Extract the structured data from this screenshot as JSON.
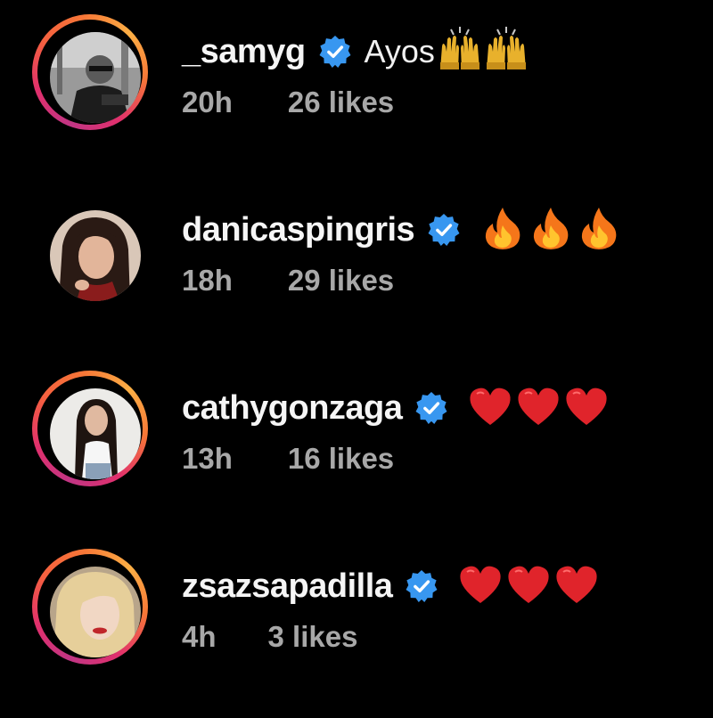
{
  "comments": [
    {
      "username": "_samyg",
      "verified": true,
      "text": "Ayos",
      "emoji": [
        "raising-hands",
        "raising-hands"
      ],
      "time": "20h",
      "likes": "26 likes",
      "has_story": true
    },
    {
      "username": "danicaspingris",
      "verified": true,
      "text": "",
      "emoji": [
        "fire",
        "fire",
        "fire"
      ],
      "time": "18h",
      "likes": "29 likes",
      "has_story": false
    },
    {
      "username": "cathygonzaga",
      "verified": true,
      "text": "",
      "emoji": [
        "red-heart",
        "red-heart",
        "red-heart"
      ],
      "time": "13h",
      "likes": "16 likes",
      "has_story": true
    },
    {
      "username": "zsazsapadilla",
      "verified": true,
      "text": "",
      "emoji": [
        "red-heart",
        "red-heart",
        "red-heart"
      ],
      "time": "4h",
      "likes": "3 likes",
      "has_story": true
    }
  ],
  "colors": {
    "background": "#000000",
    "username": "#f5f5f5",
    "meta": "#a8a8a8",
    "verified_badge": "#3897f0",
    "heart": "#e0242b",
    "ring_start": "#c13584",
    "ring_end": "#fcaf45"
  }
}
